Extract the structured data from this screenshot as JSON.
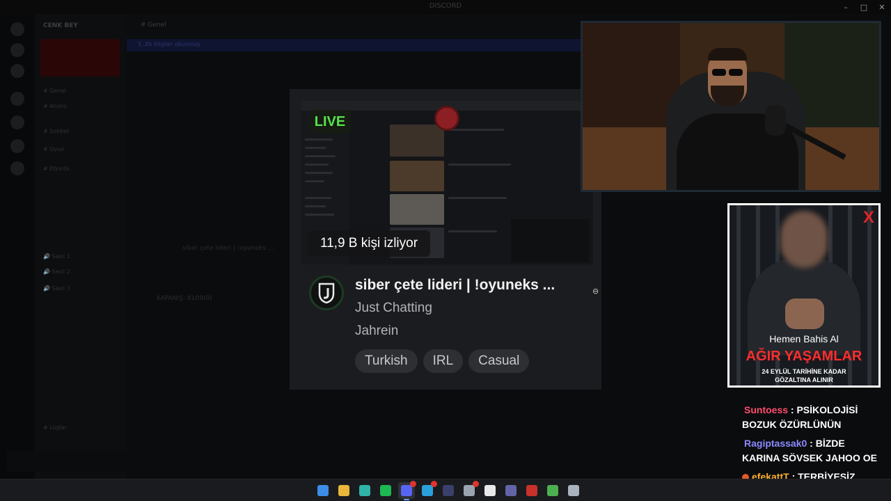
{
  "background": {
    "window_title": "DISCORD",
    "server_name": "CENK BEY",
    "chat_header": "# Genel",
    "notice": "Y...Ek bilgiler okunmuş",
    "blurred_line_1": "siber çete lideri | !oyuneks ...",
    "blurred_line_2": "KAPANIŞ: 8109(0)",
    "channels": [
      "# Genel",
      "# Anons",
      "# Sohbet",
      "# Oyun",
      "# Etkinlik",
      "🔊 Sesli 1",
      "🔊 Sesli 2",
      "🔊 Sesli 3",
      "# Loglar"
    ]
  },
  "window_controls": {
    "minimize": "–",
    "maximize": "□",
    "close": "✕"
  },
  "stream_card": {
    "live_label": "LIVE",
    "viewers": "11,9 B kişi izliyor",
    "title": "siber çete lideri | !oyuneks ...",
    "category": "Just Chatting",
    "channel": "Jahrein",
    "tags": [
      "Turkish",
      "IRL",
      "Casual"
    ]
  },
  "ad": {
    "close_label": "X",
    "small_text": "Hemen Bahis Al",
    "headline": "AĞIR YAŞAMLAR",
    "line1": "24 EYLÜL TARİHİNE KADAR",
    "line2": "GÖZALTINA ALINIR",
    "accent_color": "#ff2d2d"
  },
  "chat": [
    {
      "user": "Suntoess",
      "color": "#ff4d6d",
      "text": " : PSİKOLOJİSİ BOZUK ÖZÜRLÜNÜN"
    },
    {
      "user": "Ragiptassak0",
      "color": "#8a8aff",
      "text": " : BİZDE KARINA SÖVSEK JAHOO OE"
    },
    {
      "user": "efekattT",
      "color": "#ffb02e",
      "text": " : TERBİYESİZ HERİF"
    }
  ],
  "taskbar": {
    "apps": [
      {
        "name": "windows-start-icon",
        "color": "#3a8ee6"
      },
      {
        "name": "file-explorer-icon",
        "color": "#e9b73a"
      },
      {
        "name": "edge-browser-icon",
        "color": "#2fb3a6"
      },
      {
        "name": "spotify-icon",
        "color": "#1db954"
      },
      {
        "name": "discord-icon",
        "color": "#5865f2",
        "active": true,
        "notif": true
      },
      {
        "name": "telegram-icon",
        "color": "#2aa0da",
        "notif": true
      },
      {
        "name": "obs-icon",
        "color": "#3b3f6b"
      },
      {
        "name": "steam-icon",
        "color": "#9aa4b0",
        "notif": true
      },
      {
        "name": "notion-icon",
        "color": "#e8e8e8"
      },
      {
        "name": "teams-icon",
        "color": "#6264a7"
      },
      {
        "name": "game-launcher-icon",
        "color": "#c9312b"
      },
      {
        "name": "minecraft-icon",
        "color": "#4caf50"
      },
      {
        "name": "settings-icon",
        "color": "#a9b2bd"
      }
    ]
  }
}
